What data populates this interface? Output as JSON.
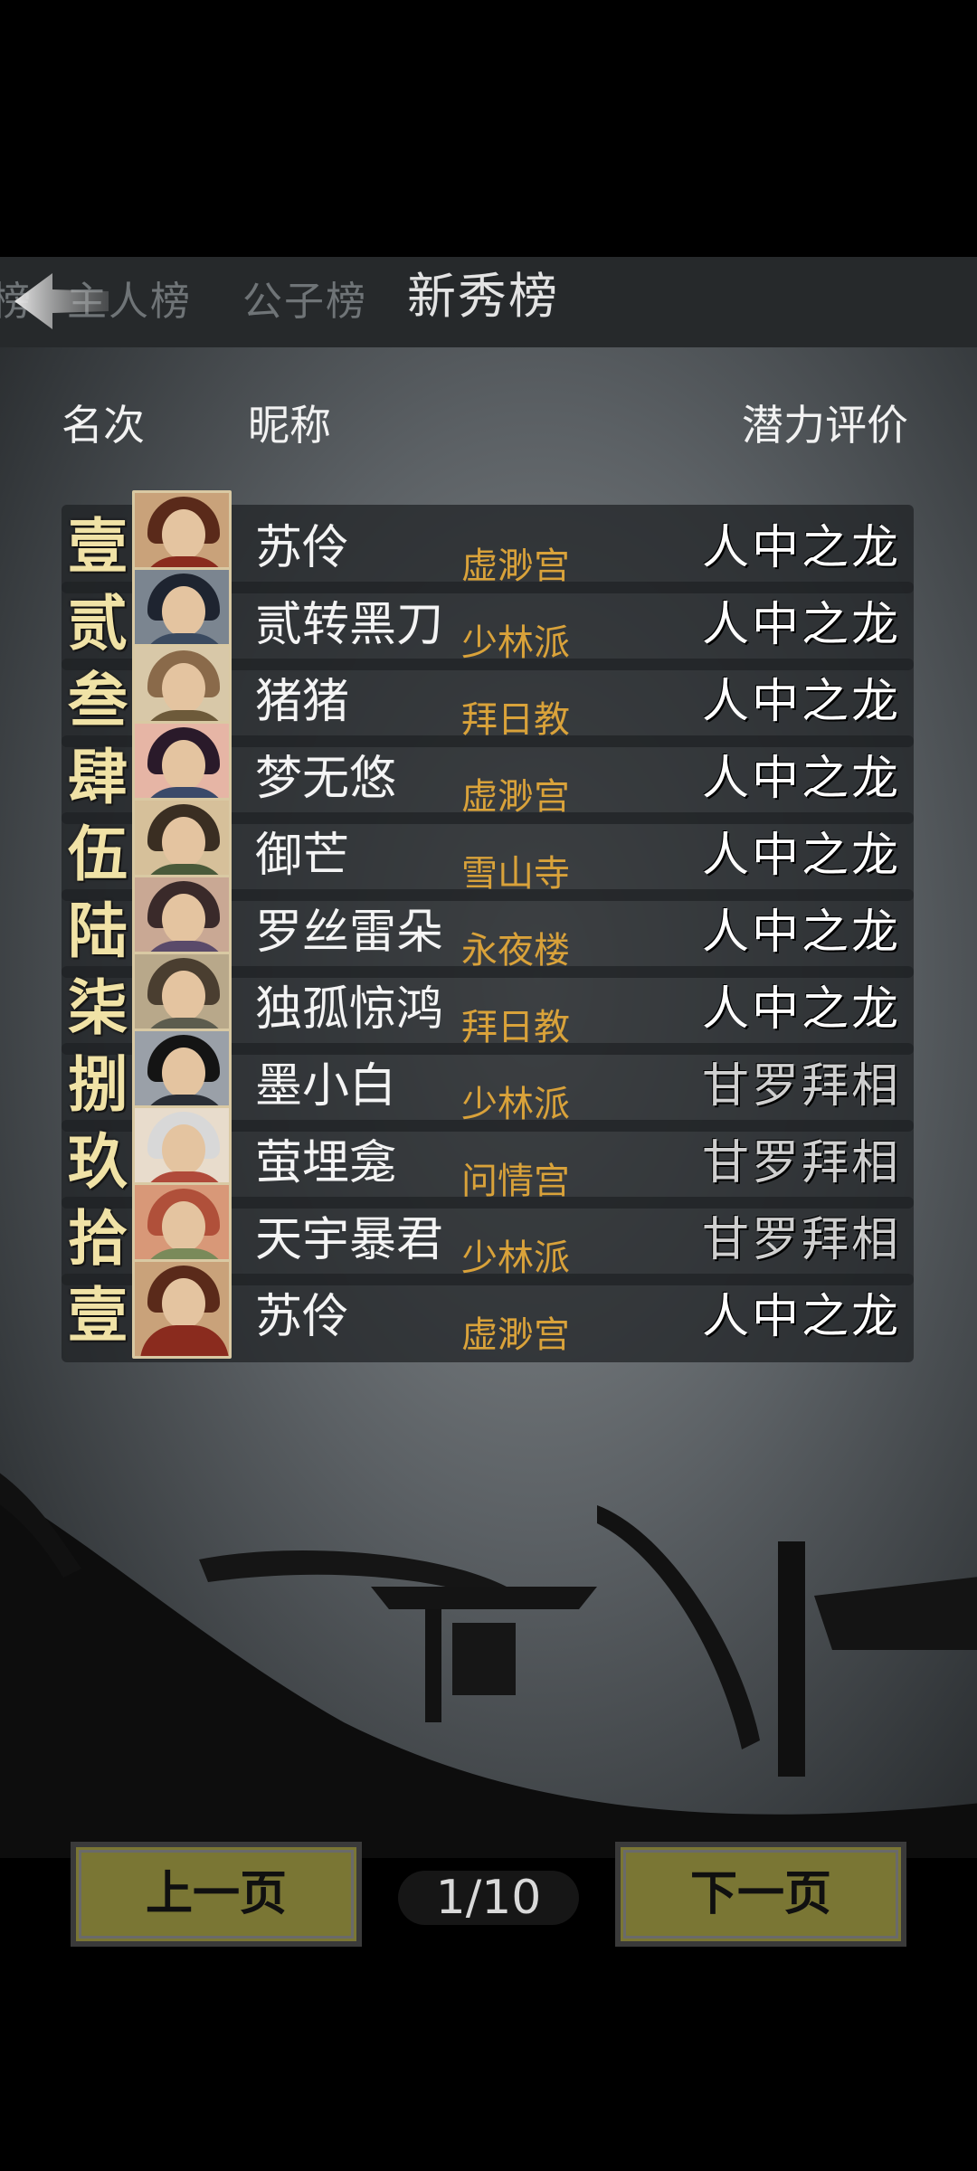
{
  "tabs": [
    {
      "label": "榜"
    },
    {
      "label": "主人榜"
    },
    {
      "label": "公子榜"
    },
    {
      "label": "新秀榜",
      "active": true
    }
  ],
  "header": {
    "rank": "名次",
    "nickname": "昵称",
    "potential": "潜力评价"
  },
  "rows": [
    {
      "rank": "壹",
      "name": "苏伶",
      "sect": "虚渺宫",
      "rating": "人中之龙"
    },
    {
      "rank": "贰",
      "name": "贰转黑刀",
      "sect": "少林派",
      "rating": "人中之龙"
    },
    {
      "rank": "叁",
      "name": "猪猪",
      "sect": "拜日教",
      "rating": "人中之龙"
    },
    {
      "rank": "肆",
      "name": "梦无悠",
      "sect": "虚渺宫",
      "rating": "人中之龙"
    },
    {
      "rank": "伍",
      "name": "御芒",
      "sect": "雪山寺",
      "rating": "人中之龙"
    },
    {
      "rank": "陆",
      "name": "罗丝雷朵",
      "sect": "永夜楼",
      "rating": "人中之龙"
    },
    {
      "rank": "柒",
      "name": "独孤惊鸿",
      "sect": "拜日教",
      "rating": "人中之龙"
    },
    {
      "rank": "捌",
      "name": "墨小白",
      "sect": "少林派",
      "rating": "甘罗拜相"
    },
    {
      "rank": "玖",
      "name": "萤埋龛",
      "sect": "问情宫",
      "rating": "甘罗拜相"
    },
    {
      "rank": "拾",
      "name": "天宇暴君",
      "sect": "少林派",
      "rating": "甘罗拜相"
    }
  ],
  "self_row": {
    "rank": "壹",
    "name": "苏伶",
    "sect": "虚渺宫",
    "rating": "人中之龙"
  },
  "pagination": {
    "prev_label": "上一页",
    "next_label": "下一页",
    "page": "1/10"
  },
  "colors": {
    "rank": "#f0e2a6",
    "sect": "#d9a23a",
    "button": "#7a7634"
  }
}
